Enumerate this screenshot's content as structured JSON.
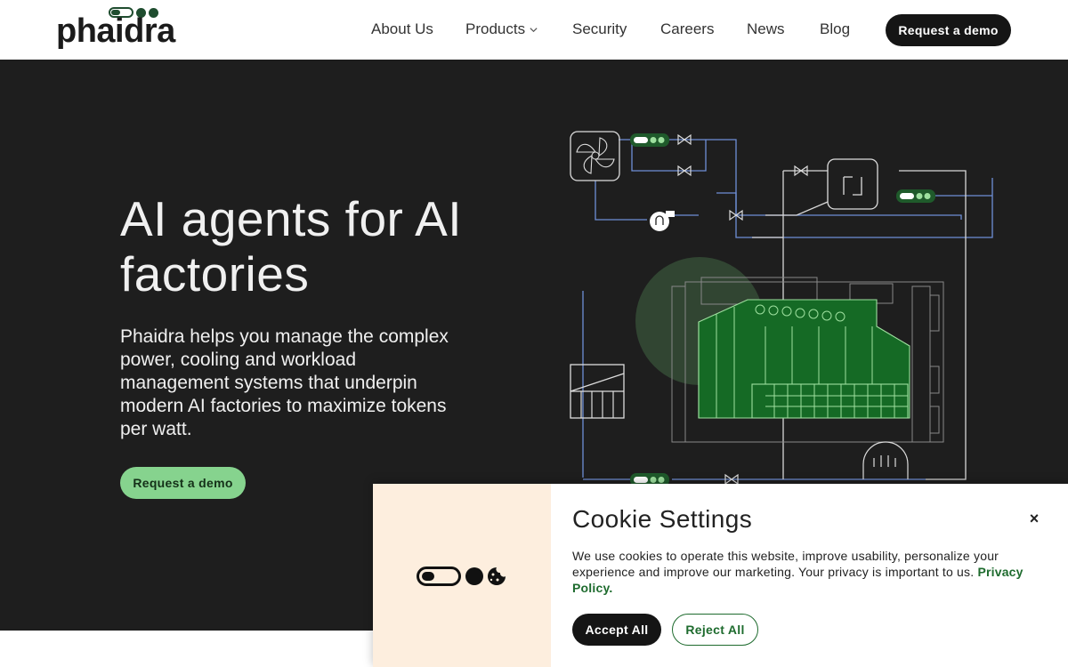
{
  "brand": {
    "name": "phaidra",
    "accent": "#1f4d2f",
    "hero_button_color": "#86d38e",
    "hero_bg": "#1e1e1e"
  },
  "nav": {
    "items": [
      {
        "label": "About Us"
      },
      {
        "label": "Products"
      },
      {
        "label": "Security"
      },
      {
        "label": "Careers"
      },
      {
        "label": "News"
      },
      {
        "label": "Blog"
      }
    ],
    "cta": "Request a demo"
  },
  "hero": {
    "title": "AI agents for AI factories",
    "text": "Phaidra helps you manage the complex power, cooling and workload management systems that underpin modern AI factories to maximize tokens per watt.",
    "cta": "Request a demo",
    "illustration": "data-center-cooling-system-diagram"
  },
  "cookie": {
    "title": "Cookie Settings",
    "text": "We use cookies to operate this website, improve usability, personalize your experience and improve our marketing. Your privacy is important to us.",
    "link": "Privacy Policy.",
    "accept": "Accept All",
    "reject": "Reject All",
    "close": "×",
    "icon": "toggle-dots-cookie-icon"
  }
}
